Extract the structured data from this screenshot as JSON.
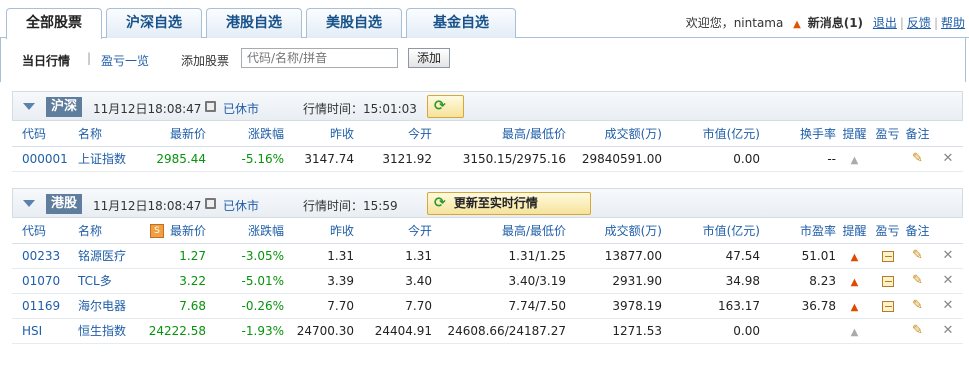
{
  "tabs": [
    "全部股票",
    "沪深自选",
    "港股自选",
    "美股自选",
    "基金自选"
  ],
  "topright": {
    "welcome": "欢迎您，nintama",
    "news": "新消息(1)",
    "logout": "退出",
    "feedback": "反馈",
    "help": "帮助"
  },
  "subnav": {
    "today": "当日行情",
    "divider": "|",
    "profit": "盈亏一览",
    "add_label": "添加股票",
    "search_placeholder": "代码/名称/拼音",
    "add_button": "添加"
  },
  "sh": {
    "market": "沪深",
    "time": "11月12日18:08:47",
    "status": "已休市",
    "quote_time": "行情时间：15:01:03",
    "columns": {
      "code": "代码",
      "name": "名称",
      "price": "最新价",
      "change": "涨跌幅",
      "prev": "昨收",
      "open": "今开",
      "hl": "最高/最低价",
      "volume": "成交额(万)",
      "mcap": "市值(亿元)",
      "turnover": "换手率",
      "alert": "提醒",
      "pl": "盈亏",
      "note": "备注"
    },
    "rows": [
      {
        "code": "000001",
        "name": "上证指数",
        "price": "2985.44",
        "change": "-5.16%",
        "prev": "3147.74",
        "open": "3121.92",
        "hl": "3150.15/2975.16",
        "volume": "29840591.00",
        "mcap": "0.00",
        "turnover": "--"
      }
    ]
  },
  "hk": {
    "market": "港股",
    "time": "11月12日18:08:47",
    "status": "已休市",
    "quote_time": "行情时间：15:59",
    "refresh": "更新至实时行情",
    "columns": {
      "code": "代码",
      "name": "名称",
      "sort_icon": "S",
      "price": "最新价",
      "change": "涨跌幅",
      "prev": "昨收",
      "open": "今开",
      "hl": "最高/最低价",
      "volume": "成交额(万)",
      "mcap": "市值(亿元)",
      "pe": "市盈率",
      "alert": "提醒",
      "pl": "盈亏",
      "note": "备注"
    },
    "rows": [
      {
        "code": "00233",
        "name": "铭源医疗",
        "price": "1.27",
        "change": "-3.05%",
        "prev": "1.31",
        "open": "1.31",
        "hl": "1.31/1.25",
        "volume": "13877.00",
        "mcap": "47.54",
        "pe": "51.01"
      },
      {
        "code": "01070",
        "name": "TCL多",
        "price": "3.22",
        "change": "-5.01%",
        "prev": "3.39",
        "open": "3.40",
        "hl": "3.40/3.19",
        "volume": "2931.90",
        "mcap": "34.98",
        "pe": "8.23"
      },
      {
        "code": "01169",
        "name": "海尔电器",
        "price": "7.68",
        "change": "-0.26%",
        "prev": "7.70",
        "open": "7.70",
        "hl": "7.74/7.50",
        "volume": "3978.19",
        "mcap": "163.17",
        "pe": "36.78"
      },
      {
        "code": "HSI",
        "name": "恒生指数",
        "price": "24222.58",
        "change": "-1.93%",
        "prev": "24700.30",
        "open": "24404.91",
        "hl": "24608.66/24187.27",
        "volume": "1271.53",
        "mcap": "0.00",
        "pe": ""
      }
    ]
  },
  "colors": {
    "link": "#1f5ea8",
    "down": "#07930b",
    "alert": "#e04a00"
  }
}
